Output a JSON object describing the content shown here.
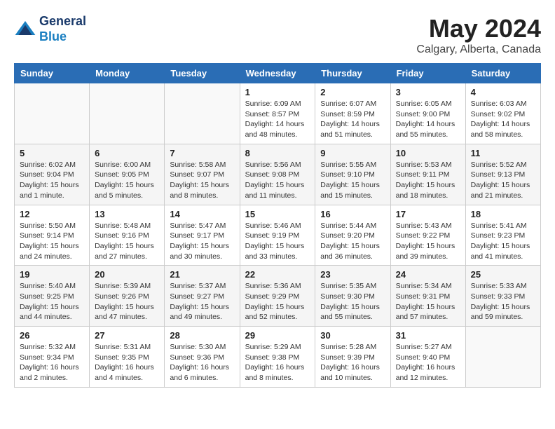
{
  "logo": {
    "line1": "General",
    "line2": "Blue"
  },
  "title": {
    "month_year": "May 2024",
    "location": "Calgary, Alberta, Canada"
  },
  "days_of_week": [
    "Sunday",
    "Monday",
    "Tuesday",
    "Wednesday",
    "Thursday",
    "Friday",
    "Saturday"
  ],
  "weeks": [
    [
      {
        "day": "",
        "info": ""
      },
      {
        "day": "",
        "info": ""
      },
      {
        "day": "",
        "info": ""
      },
      {
        "day": "1",
        "info": "Sunrise: 6:09 AM\nSunset: 8:57 PM\nDaylight: 14 hours\nand 48 minutes."
      },
      {
        "day": "2",
        "info": "Sunrise: 6:07 AM\nSunset: 8:59 PM\nDaylight: 14 hours\nand 51 minutes."
      },
      {
        "day": "3",
        "info": "Sunrise: 6:05 AM\nSunset: 9:00 PM\nDaylight: 14 hours\nand 55 minutes."
      },
      {
        "day": "4",
        "info": "Sunrise: 6:03 AM\nSunset: 9:02 PM\nDaylight: 14 hours\nand 58 minutes."
      }
    ],
    [
      {
        "day": "5",
        "info": "Sunrise: 6:02 AM\nSunset: 9:04 PM\nDaylight: 15 hours\nand 1 minute."
      },
      {
        "day": "6",
        "info": "Sunrise: 6:00 AM\nSunset: 9:05 PM\nDaylight: 15 hours\nand 5 minutes."
      },
      {
        "day": "7",
        "info": "Sunrise: 5:58 AM\nSunset: 9:07 PM\nDaylight: 15 hours\nand 8 minutes."
      },
      {
        "day": "8",
        "info": "Sunrise: 5:56 AM\nSunset: 9:08 PM\nDaylight: 15 hours\nand 11 minutes."
      },
      {
        "day": "9",
        "info": "Sunrise: 5:55 AM\nSunset: 9:10 PM\nDaylight: 15 hours\nand 15 minutes."
      },
      {
        "day": "10",
        "info": "Sunrise: 5:53 AM\nSunset: 9:11 PM\nDaylight: 15 hours\nand 18 minutes."
      },
      {
        "day": "11",
        "info": "Sunrise: 5:52 AM\nSunset: 9:13 PM\nDaylight: 15 hours\nand 21 minutes."
      }
    ],
    [
      {
        "day": "12",
        "info": "Sunrise: 5:50 AM\nSunset: 9:14 PM\nDaylight: 15 hours\nand 24 minutes."
      },
      {
        "day": "13",
        "info": "Sunrise: 5:48 AM\nSunset: 9:16 PM\nDaylight: 15 hours\nand 27 minutes."
      },
      {
        "day": "14",
        "info": "Sunrise: 5:47 AM\nSunset: 9:17 PM\nDaylight: 15 hours\nand 30 minutes."
      },
      {
        "day": "15",
        "info": "Sunrise: 5:46 AM\nSunset: 9:19 PM\nDaylight: 15 hours\nand 33 minutes."
      },
      {
        "day": "16",
        "info": "Sunrise: 5:44 AM\nSunset: 9:20 PM\nDaylight: 15 hours\nand 36 minutes."
      },
      {
        "day": "17",
        "info": "Sunrise: 5:43 AM\nSunset: 9:22 PM\nDaylight: 15 hours\nand 39 minutes."
      },
      {
        "day": "18",
        "info": "Sunrise: 5:41 AM\nSunset: 9:23 PM\nDaylight: 15 hours\nand 41 minutes."
      }
    ],
    [
      {
        "day": "19",
        "info": "Sunrise: 5:40 AM\nSunset: 9:25 PM\nDaylight: 15 hours\nand 44 minutes."
      },
      {
        "day": "20",
        "info": "Sunrise: 5:39 AM\nSunset: 9:26 PM\nDaylight: 15 hours\nand 47 minutes."
      },
      {
        "day": "21",
        "info": "Sunrise: 5:37 AM\nSunset: 9:27 PM\nDaylight: 15 hours\nand 49 minutes."
      },
      {
        "day": "22",
        "info": "Sunrise: 5:36 AM\nSunset: 9:29 PM\nDaylight: 15 hours\nand 52 minutes."
      },
      {
        "day": "23",
        "info": "Sunrise: 5:35 AM\nSunset: 9:30 PM\nDaylight: 15 hours\nand 55 minutes."
      },
      {
        "day": "24",
        "info": "Sunrise: 5:34 AM\nSunset: 9:31 PM\nDaylight: 15 hours\nand 57 minutes."
      },
      {
        "day": "25",
        "info": "Sunrise: 5:33 AM\nSunset: 9:33 PM\nDaylight: 15 hours\nand 59 minutes."
      }
    ],
    [
      {
        "day": "26",
        "info": "Sunrise: 5:32 AM\nSunset: 9:34 PM\nDaylight: 16 hours\nand 2 minutes."
      },
      {
        "day": "27",
        "info": "Sunrise: 5:31 AM\nSunset: 9:35 PM\nDaylight: 16 hours\nand 4 minutes."
      },
      {
        "day": "28",
        "info": "Sunrise: 5:30 AM\nSunset: 9:36 PM\nDaylight: 16 hours\nand 6 minutes."
      },
      {
        "day": "29",
        "info": "Sunrise: 5:29 AM\nSunset: 9:38 PM\nDaylight: 16 hours\nand 8 minutes."
      },
      {
        "day": "30",
        "info": "Sunrise: 5:28 AM\nSunset: 9:39 PM\nDaylight: 16 hours\nand 10 minutes."
      },
      {
        "day": "31",
        "info": "Sunrise: 5:27 AM\nSunset: 9:40 PM\nDaylight: 16 hours\nand 12 minutes."
      },
      {
        "day": "",
        "info": ""
      }
    ]
  ]
}
